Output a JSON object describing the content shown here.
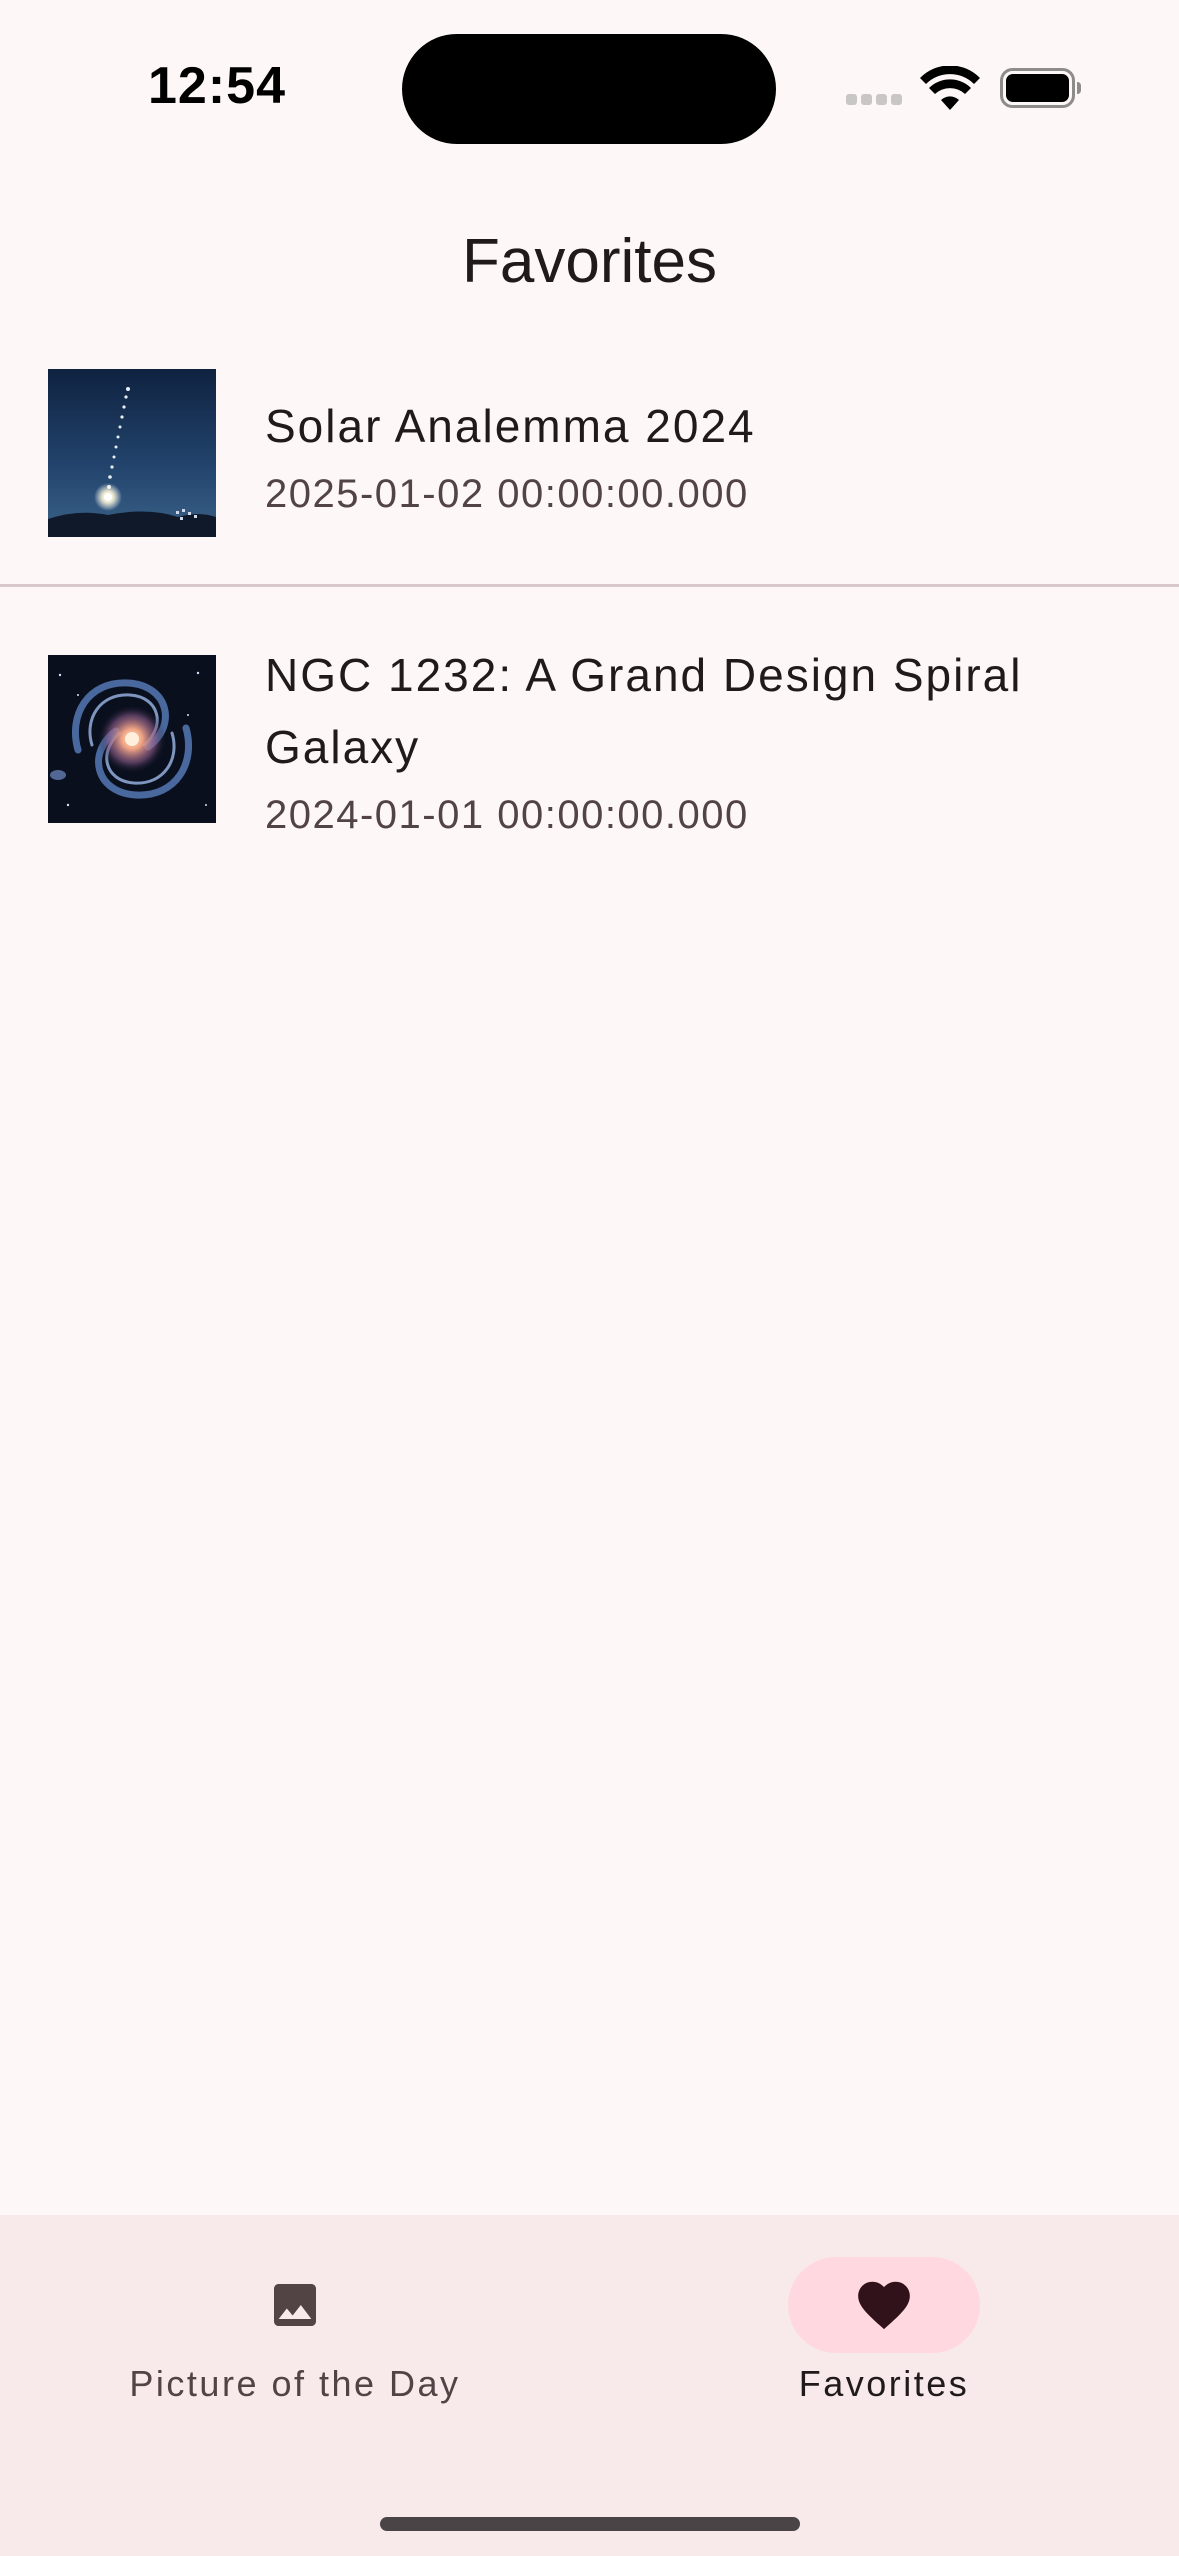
{
  "status_bar": {
    "time": "12:54"
  },
  "header": {
    "title": "Favorites"
  },
  "favorites": [
    {
      "title": "Solar Analemma 2024",
      "date": "2025-01-02 00:00:00.000",
      "thumbnail": "solar-analemma-thumbnail"
    },
    {
      "title": "NGC 1232: A Grand Design Spiral Galaxy",
      "date": "2024-01-01 00:00:00.000",
      "thumbnail": "spiral-galaxy-thumbnail"
    }
  ],
  "bottom_nav": {
    "items": [
      {
        "label": "Picture of the Day",
        "icon": "image-icon",
        "selected": false
      },
      {
        "label": "Favorites",
        "icon": "heart-icon",
        "selected": true
      }
    ]
  },
  "colors": {
    "background": "#fdf8f7",
    "nav_background": "#f8e9eb",
    "nav_indicator": "#ffd9df",
    "divider": "#d8c8c9",
    "text_primary": "#201a1b",
    "text_secondary": "#524345"
  }
}
